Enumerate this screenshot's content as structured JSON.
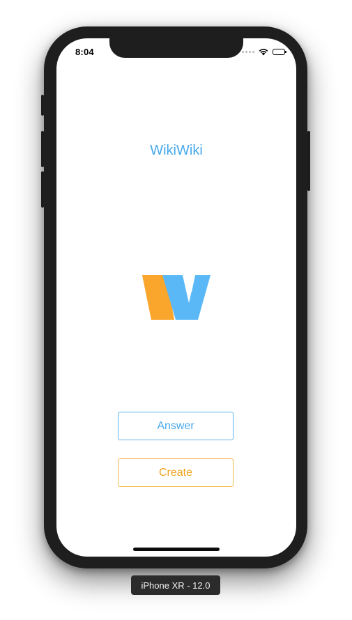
{
  "status_bar": {
    "time": "8:04"
  },
  "app": {
    "title": "WikiWiki",
    "logo_icon": "wikiwiki-w-logo",
    "answer_label": "Answer",
    "create_label": "Create"
  },
  "colors": {
    "primary_blue": "#4aa8ea",
    "accent_orange": "#f2a21e",
    "logo_blue": "#5bb8f7",
    "logo_orange": "#faa52c"
  },
  "simulator": {
    "device_label": "iPhone XR - 12.0"
  }
}
